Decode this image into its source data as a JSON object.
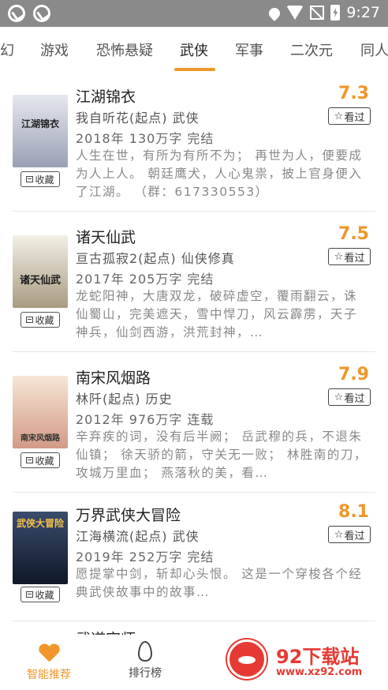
{
  "status_bar": {
    "time": "9:27"
  },
  "tabs": [
    {
      "label": "幻"
    },
    {
      "label": "游戏"
    },
    {
      "label": "恐怖悬疑"
    },
    {
      "label": "武侠"
    },
    {
      "label": "军事"
    },
    {
      "label": "二次元"
    },
    {
      "label": "同人"
    }
  ],
  "active_tab": "武侠",
  "books": [
    {
      "title": "江湖锦衣",
      "score": "7.3",
      "author_line": "我自听花(起点)  武侠",
      "meta_line": "2018年  130万字  完结",
      "description": "人生在世，有所为有所不为；  再世为人，便要成为人上人。  朝廷鹰犬，人心鬼祟，披上官身便入了江湖。  （群：617330553）",
      "cover_text": "江湖锦衣",
      "cover_colors": [
        "#d9dce6",
        "#6e7388"
      ]
    },
    {
      "title": "诸天仙武",
      "score": "7.5",
      "author_line": "亘古孤寂2(起点)  仙侠修真",
      "meta_line": "2017年  205万字  完结",
      "description": "龙蛇阳神，大唐双龙，破碎虚空，覆雨翻云，诛仙蜀山，完美遮天，雪中悍刀，风云霹雳，天子神兵，仙剑西游，洪荒封神，…",
      "cover_text": "诸天仙武",
      "cover_colors": [
        "#eae6dc",
        "#7a6e5a"
      ]
    },
    {
      "title": "南宋风烟路",
      "score": "7.9",
      "author_line": "林阡(起点)  历史",
      "meta_line": "2012年  976万字  连载",
      "description": "辛弃疾的词，没有后半阙；  岳武穆的兵，不退朱仙镇；  徐天骄的箭，守关无一败；  林胜南的刀，攻城万里血；  燕落秋的美，看…",
      "cover_text": "南宋风烟路",
      "cover_colors": [
        "#f0dcc8",
        "#c8806e"
      ]
    },
    {
      "title": "万界武侠大冒险",
      "score": "8.1",
      "author_line": "江海横流(起点)  武侠",
      "meta_line": "2019年  252万字  完结",
      "description": "愿提掌中剑，斩却心头恨。  这是一个穿梭各个经典武侠故事中的故事…",
      "cover_text": "武侠大冒险",
      "cover_colors": [
        "#2a3a5a",
        "#0e1626"
      ]
    },
    {
      "title": "武道宗师",
      "score": "",
      "author_line": "",
      "meta_line": "",
      "description": "",
      "cover_text": "",
      "cover_colors": [
        "#ffffff",
        "#ffffff"
      ]
    }
  ],
  "labels": {
    "favorite": "收藏",
    "seen": "看过"
  },
  "bottom_nav": [
    {
      "label": "智能推荐",
      "icon": "heart-icon",
      "active": true
    },
    {
      "label": "排行榜",
      "icon": "flame-icon",
      "active": false
    }
  ],
  "watermark": {
    "text": "92下载站",
    "url": "www.xz92.com"
  },
  "colors": {
    "accent": "#f0962a",
    "status_bar": "#8a8a8a",
    "watermark": "#e53a34"
  }
}
